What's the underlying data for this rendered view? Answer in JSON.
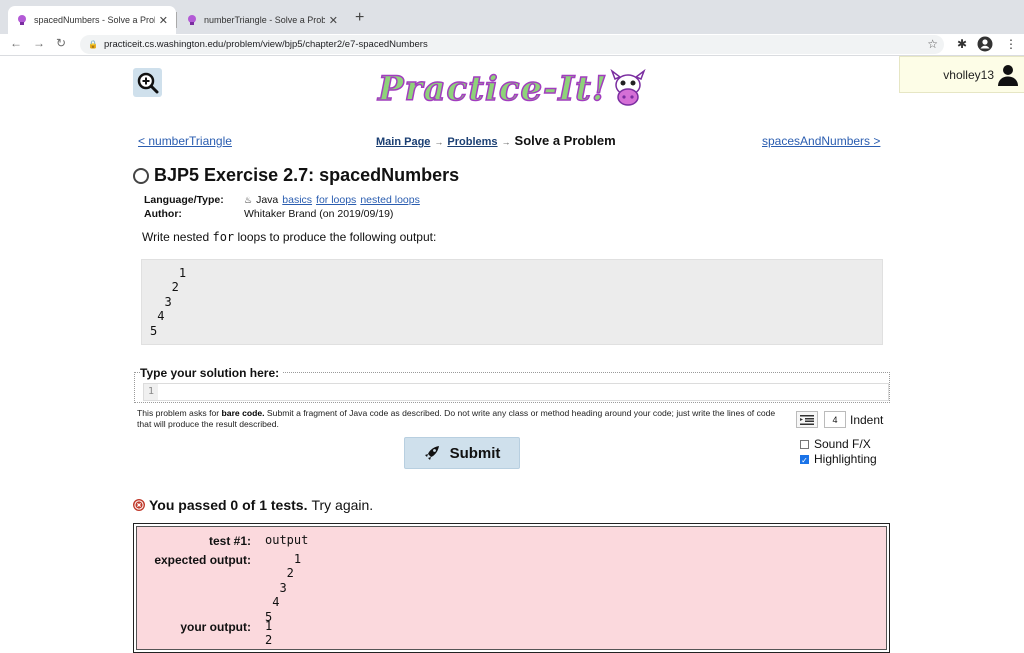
{
  "browser": {
    "tabs": [
      {
        "title": "spacedNumbers - Solve a Prob",
        "active": true
      },
      {
        "title": "numberTriangle - Solve a Prob",
        "active": false
      }
    ],
    "url": "practiceit.cs.washington.edu/problem/view/bjp5/chapter2/e7-spacedNumbers"
  },
  "header": {
    "logo_text": "Practice-It!",
    "username": "vholley13"
  },
  "nav": {
    "prev": "< numberTriangle",
    "next": "spacesAndNumbers >",
    "breadcrumb": [
      "Main Page",
      "Problems"
    ],
    "current": "Solve a Problem"
  },
  "problem": {
    "title": "BJP5 Exercise 2.7: spacedNumbers",
    "language_label": "Language/Type:",
    "language": "Java",
    "tags": [
      "basics",
      "for loops",
      "nested loops"
    ],
    "author_label": "Author:",
    "author": "Whitaker Brand (on 2019/09/19)",
    "instr_before": "Write nested ",
    "instr_code": "for",
    "instr_after": " loops to produce the following output:",
    "expected_output": "    1\n   2\n  3\n 4\n5"
  },
  "solution": {
    "label": "Type your solution here:",
    "line_number": "1",
    "note_p1": "This problem asks for ",
    "note_bold": "bare code.",
    "note_p2": " Submit a fragment of Java code as described. Do not write any class or method heading around your code; just write the lines of code that will produce the result described.",
    "indent_value": "4",
    "indent_label": "Indent",
    "sound_label": "Sound F/X",
    "highlight_label": "Highlighting",
    "submit_label": "Submit"
  },
  "results": {
    "bold": "You passed 0 of 1 tests.",
    "rest": "Try again.",
    "test_label": "test #1:",
    "test_type": "output",
    "expected_label": "expected output:",
    "expected": "    1\n   2\n  3\n 4\n5",
    "your_label": "your output:",
    "yours": "1\n2"
  }
}
